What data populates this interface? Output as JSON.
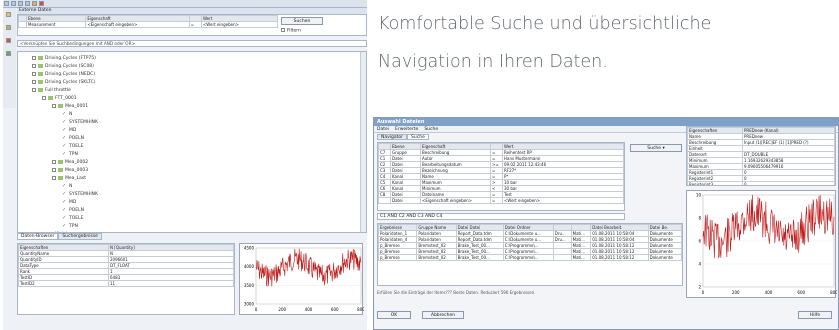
{
  "tagline": {
    "line1": "Komfortable Suche und übersichtliche",
    "line2": "Navigation in Ihren Daten."
  },
  "left_window": {
    "section_label": "Externe Daten",
    "search_headers": [
      "Ebene",
      "Eigenschaft",
      "Wert"
    ],
    "search_row": [
      "Measurement",
      "<Eigenschaft eingeben>",
      "=",
      "<Wert eingeben>"
    ],
    "search_button": "Suchen",
    "filter_label": "Filtern",
    "combine_hint": "<Verknüpfen Sie Suchbedingungen mit AND oder OR>",
    "tree": [
      {
        "label": "Driving Cycles (FTP75)",
        "indent": 1,
        "kind": "folder"
      },
      {
        "label": "Driving Cycles (SC08)",
        "indent": 1,
        "kind": "folder"
      },
      {
        "label": "Driving Cycles (NEDC)",
        "indent": 1,
        "kind": "folder"
      },
      {
        "label": "Driving Cycles (SKLTC)",
        "indent": 1,
        "kind": "folder"
      },
      {
        "label": "Full throttle",
        "indent": 1,
        "kind": "folder"
      },
      {
        "label": "FTT_0001",
        "indent": 2,
        "kind": "folder"
      },
      {
        "label": "Mea_0001",
        "indent": 3,
        "kind": "folder"
      },
      {
        "label": "N",
        "indent": 4,
        "kind": "check"
      },
      {
        "label": "SYSTEMHINK",
        "indent": 4,
        "kind": "check"
      },
      {
        "label": "MD",
        "indent": 4,
        "kind": "check"
      },
      {
        "label": "POELN",
        "indent": 4,
        "kind": "check"
      },
      {
        "label": "TOELE",
        "indent": 4,
        "kind": "check"
      },
      {
        "label": "TPN",
        "indent": 4,
        "kind": "check"
      },
      {
        "label": "Mea_0002",
        "indent": 3,
        "kind": "folder"
      },
      {
        "label": "Mea_0003",
        "indent": 3,
        "kind": "folder"
      },
      {
        "label": "Mea_Last",
        "indent": 3,
        "kind": "folder"
      },
      {
        "label": "N",
        "indent": 4,
        "kind": "check"
      },
      {
        "label": "SYSTEMHINK",
        "indent": 4,
        "kind": "check"
      },
      {
        "label": "MD",
        "indent": 4,
        "kind": "check"
      },
      {
        "label": "POELN",
        "indent": 4,
        "kind": "check"
      },
      {
        "label": "TOELE",
        "indent": 4,
        "kind": "check"
      },
      {
        "label": "TPN",
        "indent": 4,
        "kind": "check"
      },
      {
        "label": "Kickdown",
        "indent": 2,
        "kind": "folder"
      }
    ],
    "tabs": [
      "Daten-Browser",
      "Suchergebnisse"
    ],
    "props_headers": [
      "Eigenschaften",
      "N [Quantity]"
    ],
    "props_rows": [
      [
        "QuantityName",
        "N"
      ],
      [
        "QuantityID",
        "2096601"
      ],
      [
        "DataType",
        "DT_FLOAT"
      ],
      [
        "Rank",
        "1"
      ],
      [
        "TestID",
        "6483"
      ],
      [
        "TestID2",
        "11"
      ]
    ],
    "plot_yticks": [
      "4500",
      "4000",
      "3500",
      "3000"
    ],
    "plot_xticks": [
      "0",
      "200",
      "400",
      "600",
      "800"
    ]
  },
  "right_window": {
    "title": "Auswahl Dateien",
    "menu": [
      "Datei",
      "Erweiterte",
      "Suche"
    ],
    "tabs": [
      "Navigator",
      "Suche"
    ],
    "query_headers": [
      "",
      "Ebene",
      "Eigenschaft",
      "",
      "Wert"
    ],
    "query_rows": [
      [
        "C7",
        "Gruppe",
        "Beschreibung",
        "=",
        "Reihentest RP"
      ],
      [
        "C1",
        "Datei",
        "Autor",
        "=",
        "Hans Mustermann"
      ],
      [
        "C2",
        "Datei",
        "Bearbeitungsdatum",
        ">=",
        "09.02.2011 12:43:46"
      ],
      [
        "C3",
        "Datei",
        "Bezeichnung",
        "=",
        "RF27*"
      ],
      [
        "C4",
        "Kanal",
        "Name",
        "=",
        "P*"
      ],
      [
        "C5",
        "Kanal",
        "Maximum",
        ">",
        "10 bar"
      ],
      [
        "C6",
        "Kanal",
        "Minimum",
        "<",
        "30 bar"
      ],
      [
        "C8",
        "Datei",
        "Dateiname",
        "=",
        "Test"
      ],
      [
        "",
        "Datei",
        "<Eigenschaft eingeben>",
        "=",
        "<Wert eingeben>"
      ]
    ],
    "search_button": "Suche",
    "expression": "C1 AND C2 AND C3 AND C4",
    "result_headers": [
      "Ergebnisse",
      "Gruppe Name",
      "Datei Datei",
      "Datei Ordner",
      "",
      "",
      "Datei Bearbeit.",
      "Datei Be."
    ],
    "result_rows": [
      [
        "Polaridaten_1",
        "Polaridaten",
        "Report_Data.tdm",
        "C:\\Dokumente u...",
        "Dru...",
        "Mati...",
        "01.08.2011 10:58:04",
        "Dokumente"
      ],
      [
        "Polaridaten_4",
        "Polaridaten",
        "Report_Data.tdm",
        "C:\\Dokumente u...",
        "Dru...",
        "Mati...",
        "01.08.2011 10:58:04",
        "Dokumente"
      ],
      [
        "p_Bremse",
        "Bremstest_02",
        "Brake_Test_00...",
        "C:\\Programme\\...",
        "",
        "Mati...",
        "01.08.2011 10:58:12",
        "Dokumente"
      ],
      [
        "p_Bremse",
        "Bremstest_02",
        "Brake_Test_00...",
        "C:\\Programme\\...",
        "",
        "Mati...",
        "01.08.2011 10:58:12",
        "Dokumente"
      ],
      [
        "p_Bremse",
        "Bremstest_02",
        "Brake_Test_00...",
        "C:\\Programme\\...",
        "",
        "Mati...",
        "01.08.2011 10:58:12",
        "Dokumente"
      ]
    ],
    "status": "Erfüllen Sie die Einträge der Items??? Beste Daten. Reduziert 596 Ergebnissen.",
    "ok_button": "OK",
    "cancel_button": "Abbrechen",
    "help_button": "Hilfe",
    "props_headers": [
      "Eigenschaften",
      "PREDnew (Kanal)"
    ],
    "props_rows": [
      [
        "Name",
        "PREDnew"
      ],
      [
        "Beschreibung",
        "Input (1)[REC]EF (1) [1]PRED (?)"
      ],
      [
        "Einheit",
        ""
      ],
      [
        "Datenart",
        "DT_DOUBLE"
      ],
      [
        "Minimum",
        "1.16932629343858"
      ],
      [
        "Maximum",
        "9.09005506479916"
      ],
      [
        "Registerint1",
        "0"
      ],
      [
        "Registerint2",
        "0"
      ],
      [
        "Registerint3",
        "0"
      ]
    ],
    "plot_yticks": [
      "10",
      "8",
      "6",
      "4",
      "2"
    ],
    "plot_xticks": [
      "0",
      "200",
      "400",
      "600",
      "800"
    ]
  }
}
